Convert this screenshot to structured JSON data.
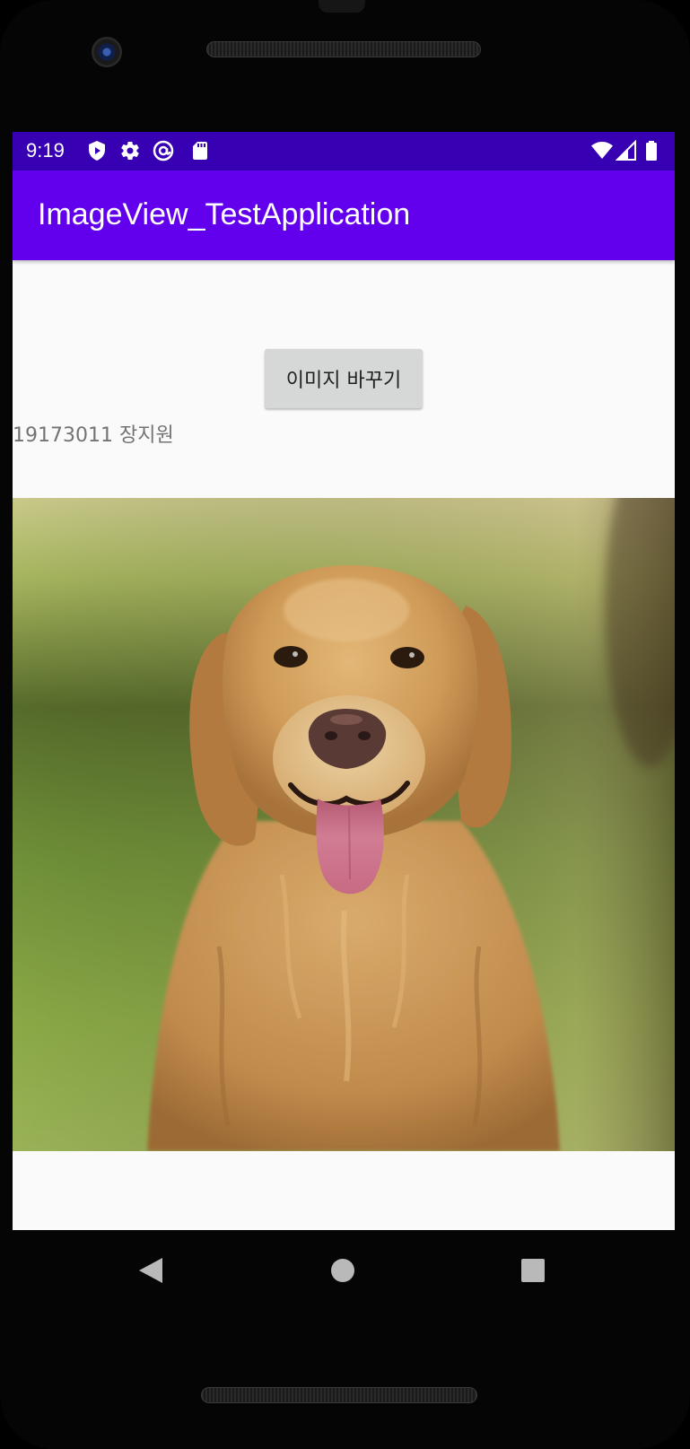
{
  "status_bar": {
    "time": "9:19",
    "left_icons": [
      "shield-icon",
      "gear-icon",
      "at-sign-icon",
      "sd-card-icon"
    ],
    "right_icons": [
      "wifi-icon",
      "cell-signal-icon",
      "battery-icon"
    ],
    "background": "#3700b3"
  },
  "app_bar": {
    "title": "ImageView_TestApplication",
    "background": "#6200ee"
  },
  "content": {
    "button_label": "이미지 바꾸기",
    "student_label": "19173011 장지원",
    "image": {
      "subject": "golden-retriever-dog-photo"
    }
  },
  "nav_bar": {
    "buttons": [
      "back-icon",
      "home-icon",
      "recents-icon"
    ]
  }
}
